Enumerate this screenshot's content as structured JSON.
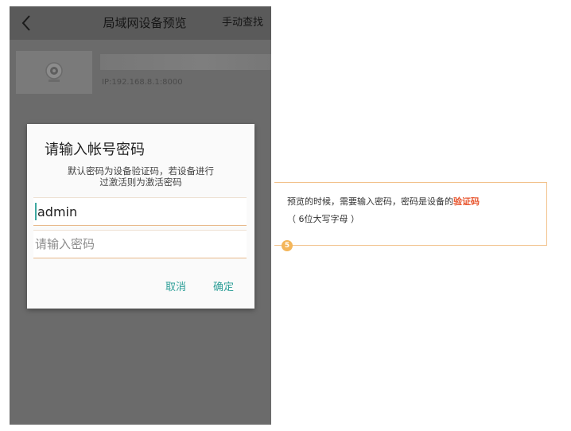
{
  "topbar": {
    "title": "局域网设备预览",
    "action_label": "手动查找"
  },
  "device": {
    "ip": "IP:192.168.8.1:8000"
  },
  "dialog": {
    "title": "请输入帐号密码",
    "hint_line1": "默认密码为设备验证码，若设备进行",
    "hint_line2": "过激活则为激活密码",
    "username_value": "admin",
    "password_placeholder": "请输入密码",
    "cancel_label": "取消",
    "confirm_label": "确定"
  },
  "callout": {
    "text_prefix": "预览的时候，需要输入密码，密码是设备的",
    "highlight": "验证码",
    "text_suffix": "（ 6位大写字母 ）",
    "step_number": "5"
  },
  "colors": {
    "accent": "#2e9f98",
    "highlight": "#e8562f",
    "badge": "#f4b65a"
  }
}
